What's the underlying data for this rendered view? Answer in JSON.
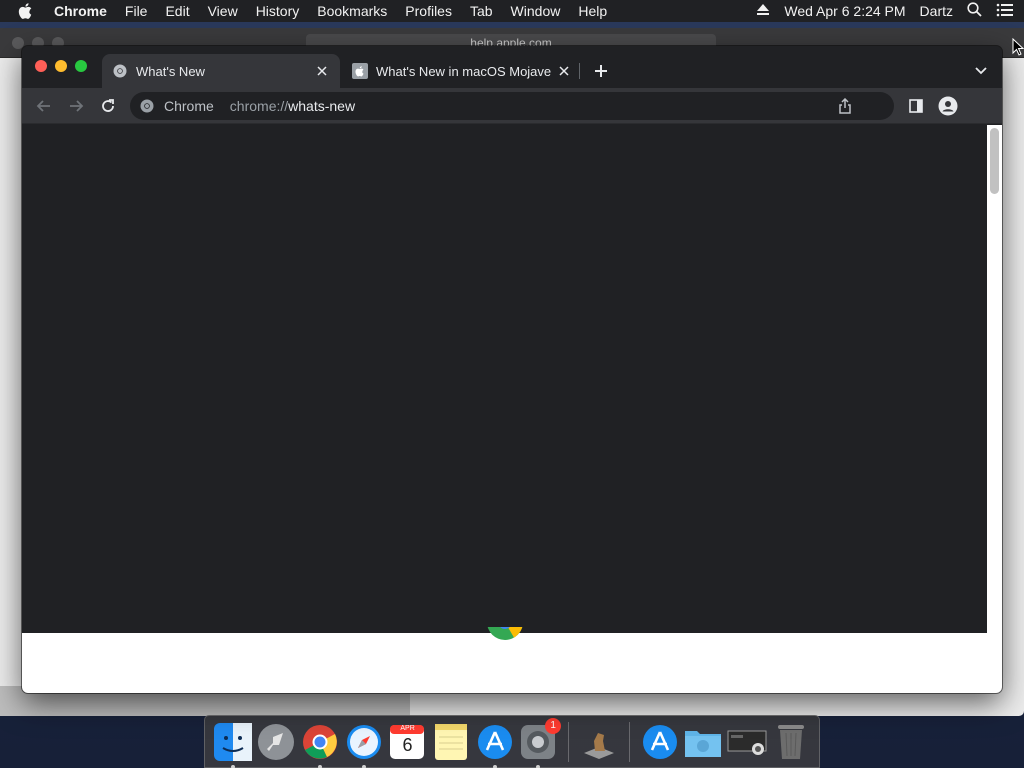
{
  "menubar": {
    "app_name": "Chrome",
    "items": [
      "File",
      "Edit",
      "View",
      "History",
      "Bookmarks",
      "Profiles",
      "Tab",
      "Window",
      "Help"
    ],
    "datetime": "Wed Apr 6  2:24 PM",
    "user": "Dartz"
  },
  "background_window": {
    "url": "help.apple.com"
  },
  "tabs": [
    {
      "title": "What's New",
      "active": true
    },
    {
      "title": "What's New in macOS Mojave",
      "active": false
    }
  ],
  "omnibox": {
    "chip_label": "Chrome",
    "url_scheme": "chrome://",
    "url_host": "whats-new"
  },
  "dock": {
    "apps": [
      "Finder",
      "Launchpad",
      "Google Chrome",
      "Safari",
      "Calendar",
      "Notes",
      "App Store",
      "System Preferences",
      "Chess",
      "App Store",
      "Downloads",
      "Screenshot",
      "Trash"
    ],
    "calendar_month": "APR",
    "calendar_day": "6",
    "system_prefs_badge": "1"
  },
  "colors": {
    "chrome_frame": "#202124",
    "toolbar": "#35363a",
    "menubar": "#202124"
  }
}
